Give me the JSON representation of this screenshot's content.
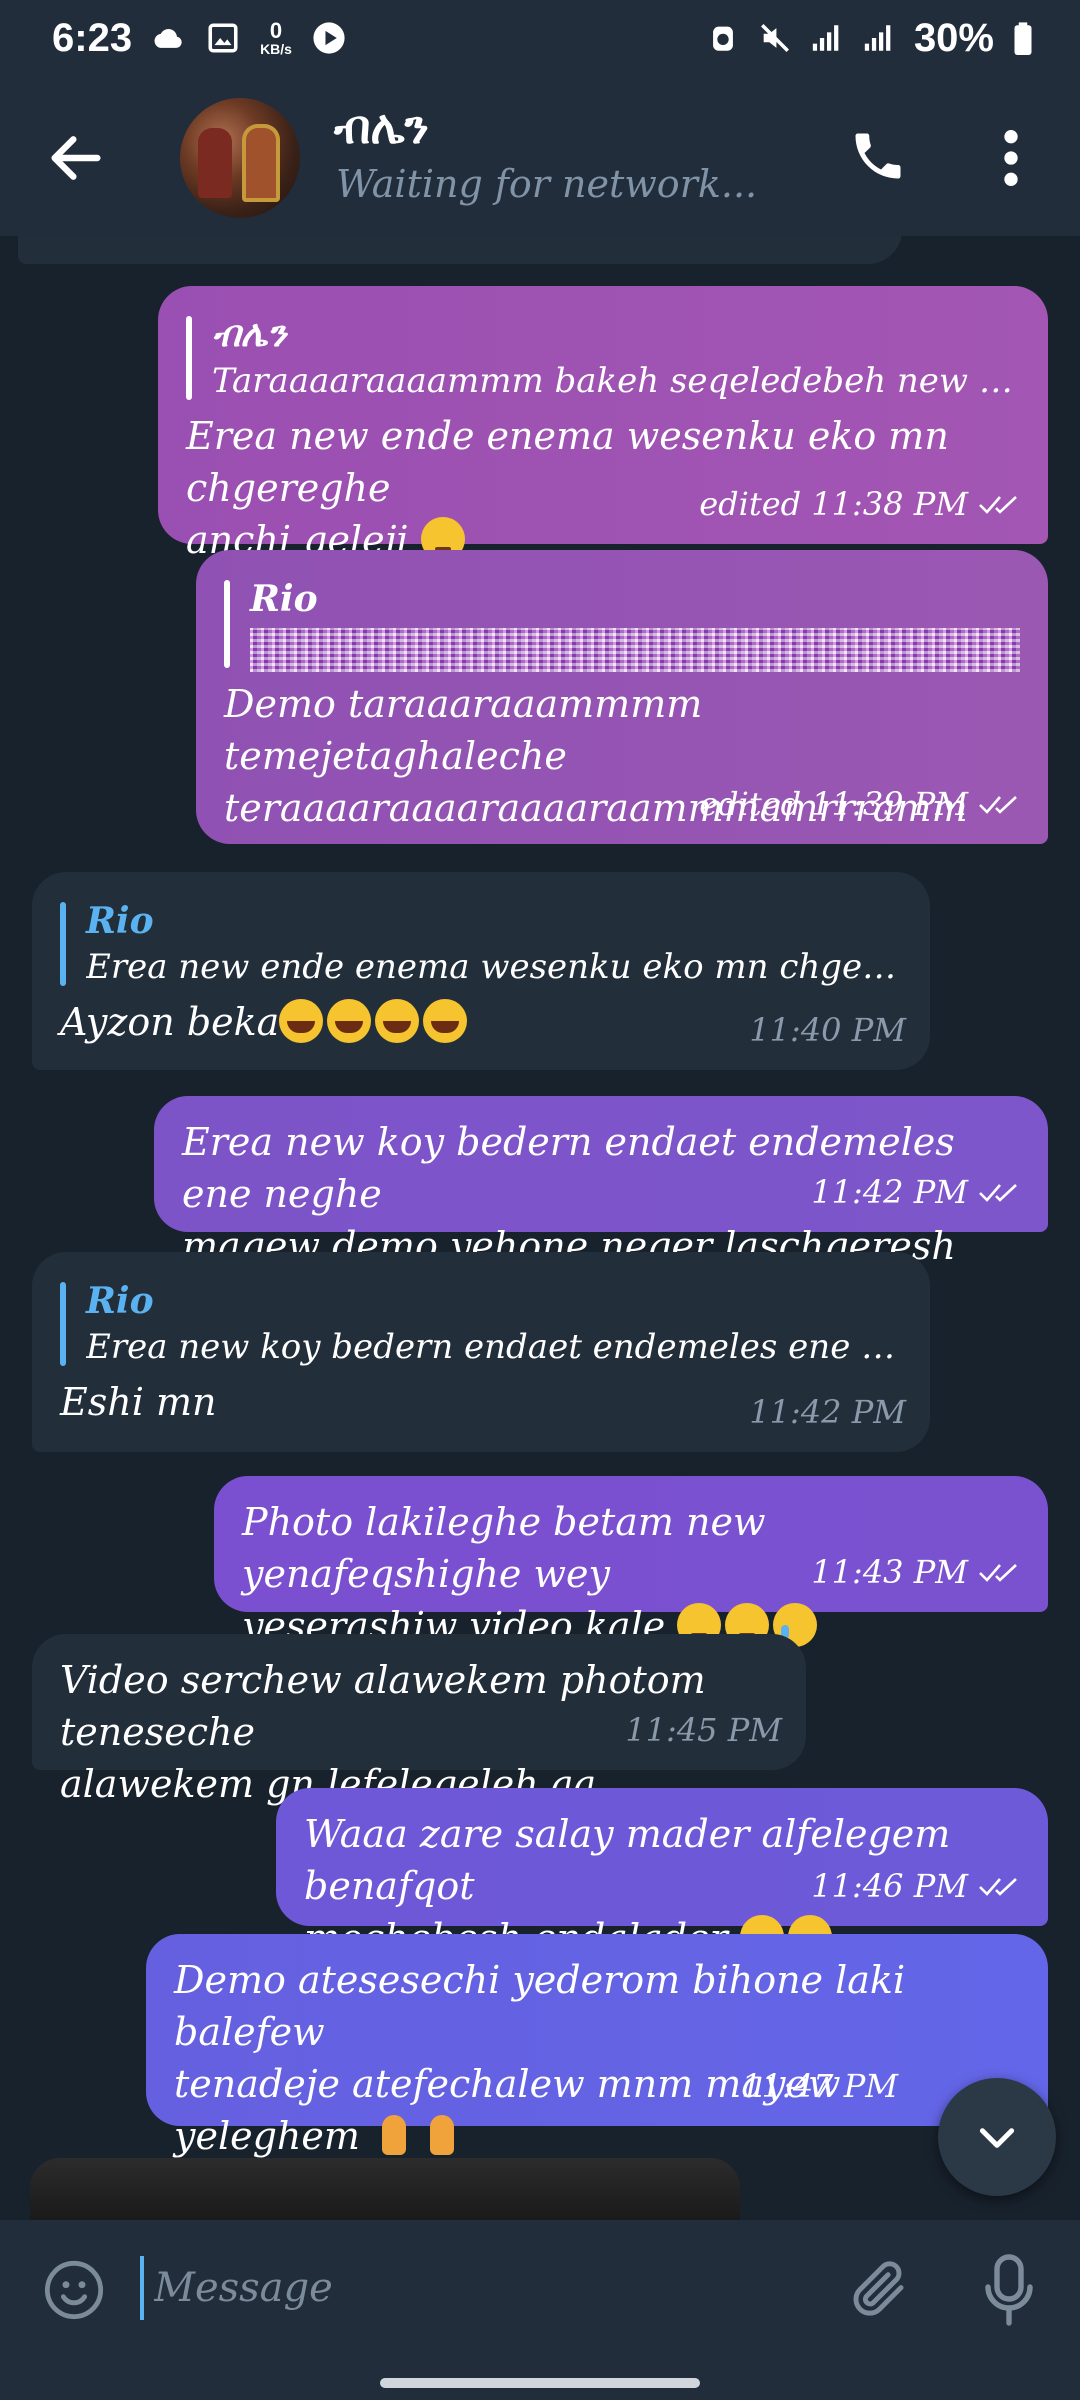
{
  "status_bar": {
    "time": "6:23",
    "net_speed_value": "0",
    "net_speed_unit": "KB/s",
    "battery": "30%"
  },
  "header": {
    "name": "ብሌን",
    "status": "Waiting for network..."
  },
  "messages": [
    {
      "reply_name": "ብሌን",
      "reply_text": "Taraaaaraaaammm bakeh seqeledebeh new agegneweh...",
      "text_line1": "Erea new ende enema wesenku eko mn chgereghe",
      "text_line2": "anchi qeleji",
      "time": "edited 11:38 PM"
    },
    {
      "reply_name": "Rio",
      "text_line1": "Demo taraaaraaammmm temejetaghaleche",
      "text_line2": "teraaaaraaaaraaaaraammmamrrramm",
      "time": "edited 11:39 PM"
    },
    {
      "reply_name": "Rio",
      "reply_text": "Erea new ende enema wesenku eko mn chgereghe anc...",
      "text": "Ayzon beka",
      "time": "11:40 PM"
    },
    {
      "text_line1": "Erea new koy bedern endaet endemeles ene neghe",
      "text_line2": "maqew demo yehone neger laschgeresh",
      "time": "11:42 PM"
    },
    {
      "reply_name": "Rio",
      "reply_text": "Erea new koy bedern endaet endemeles ene neghe ma...",
      "text": "Eshi mn",
      "time": "11:42 PM"
    },
    {
      "text_line1": "Photo lakileghe betam new yenafeqshighe wey",
      "text_line2": "yeserashiw video kale",
      "time": "11:43 PM"
    },
    {
      "text_line1": "Video serchew alawekem photom teneseche",
      "text_line2": "alawekem gn lefelegeleh aa",
      "time": "11:45 PM"
    },
    {
      "text_line1": "Waaa zare salay mader alfelegem benafqot",
      "text_line2": "mochebesh endalader",
      "time": "11:46 PM"
    },
    {
      "text_line1": "Demo atesesechi yederom bihone laki balefew",
      "text_line2": "tenadeje atefechalew mnm mayew yeleghem",
      "time": "11:47 PM"
    }
  ],
  "input": {
    "placeholder": "Message"
  },
  "colors": {
    "background": "#18222d",
    "bar": "#212d3b",
    "incoming_bubble": "#222e3a",
    "accent_blue": "#5ab3f0"
  },
  "icons": {
    "status": [
      "cloud-icon",
      "image-icon",
      "play-icon",
      "alarm-icon",
      "mute-icon",
      "signal-icon",
      "battery-icon"
    ],
    "header": [
      "back-arrow-icon",
      "phone-icon",
      "more-vert-icon"
    ],
    "input": [
      "emoji-icon",
      "paperclip-icon",
      "microphone-icon"
    ]
  }
}
